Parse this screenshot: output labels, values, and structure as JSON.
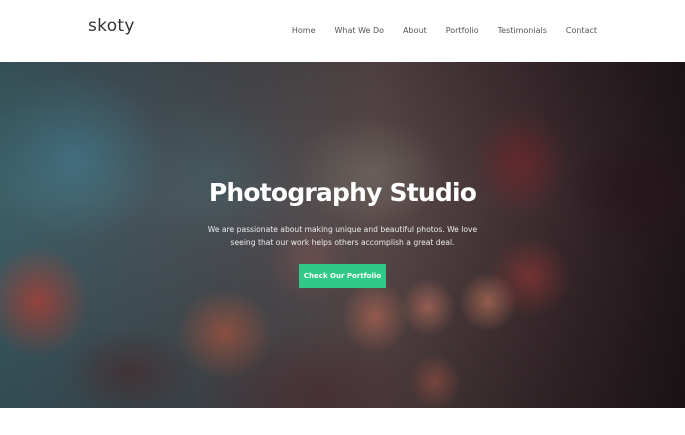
{
  "header": {
    "logo": "skoty",
    "nav": [
      "Home",
      "What We Do",
      "About",
      "Portfolio",
      "Testimonials",
      "Contact"
    ]
  },
  "hero": {
    "title": "Photography Studio",
    "description": "We are passionate about making unique and beautiful photos. We love seeing that our work helps others accomplish a great deal.",
    "button_label": "Check Our Portfolio",
    "button_color": "#2fca87"
  }
}
